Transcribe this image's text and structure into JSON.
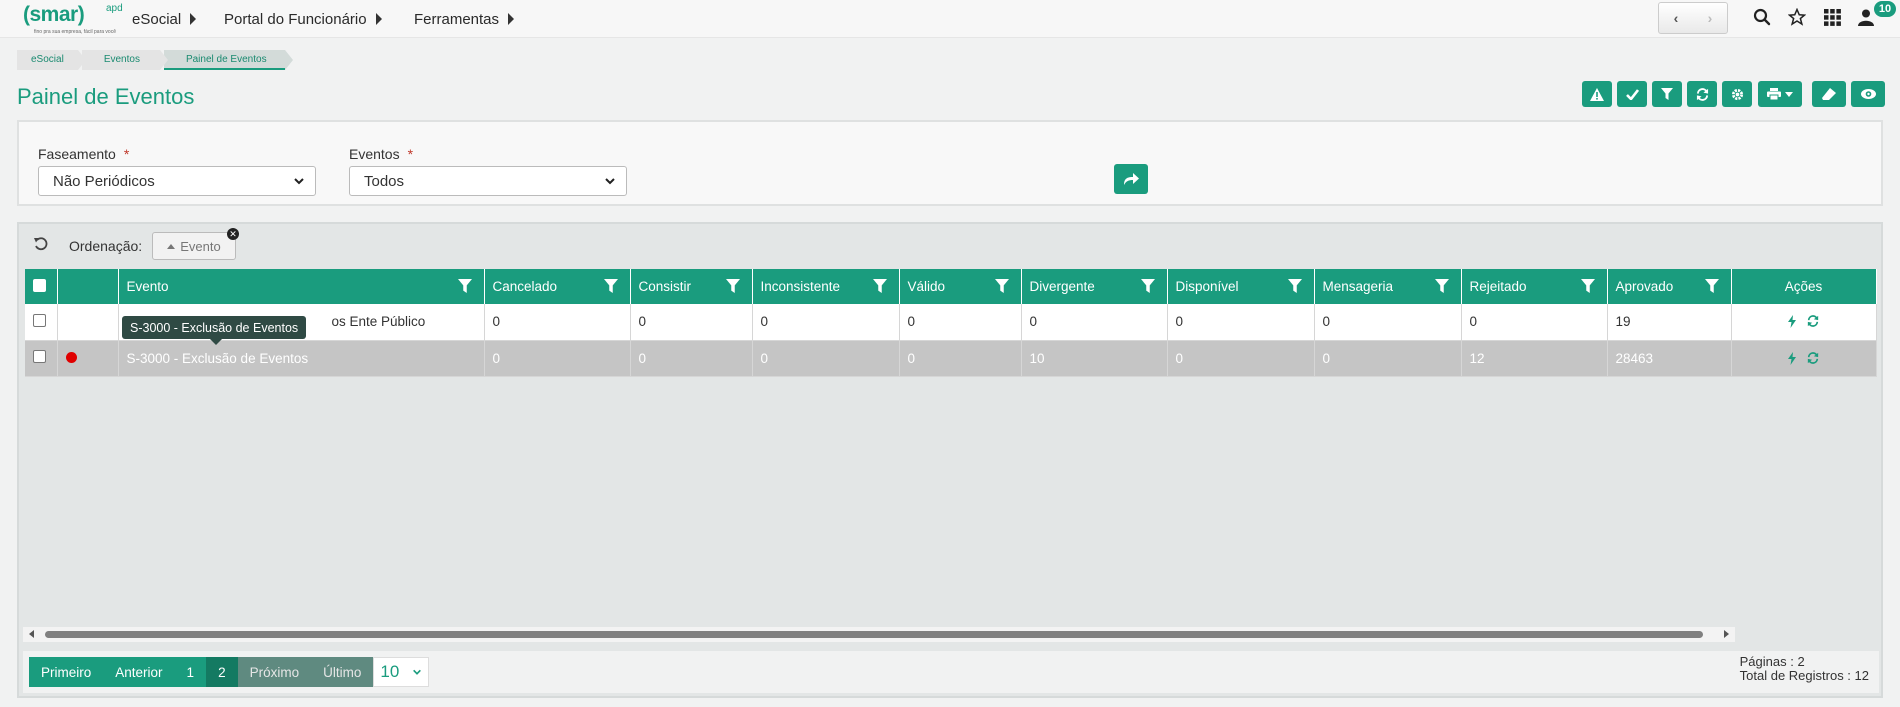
{
  "logo": {
    "text": "(smar)",
    "sup": "apd",
    "tagline": "fino pra sua empresa, fácil para você"
  },
  "nav": {
    "items": [
      {
        "label": "eSocial"
      },
      {
        "label": "Portal do Funcionário"
      },
      {
        "label": "Ferramentas"
      }
    ],
    "badge": "10",
    "icons": [
      "search-icon",
      "star-icon",
      "apps-grid-icon",
      "user-icon"
    ]
  },
  "breadcrumb": {
    "items": [
      "eSocial",
      "Eventos",
      "Painel de Eventos"
    ]
  },
  "page": {
    "title": "Painel de Eventos"
  },
  "toolbar": {
    "icons": [
      "warning-icon",
      "check-icon",
      "filter-icon",
      "refresh-icon",
      "settings-icon",
      "print-icon",
      "eraser-icon",
      "eye-icon"
    ]
  },
  "filters": {
    "faseamento": {
      "label": "Faseamento",
      "required": "*",
      "value": "Não Periódicos"
    },
    "eventos": {
      "label": "Eventos",
      "required": "*",
      "value": "Todos"
    }
  },
  "ordering": {
    "label": "Ordenação:",
    "chip": "Evento"
  },
  "grid": {
    "columns": [
      "Evento",
      "Cancelado",
      "Consistir",
      "Inconsistente",
      "Válido",
      "Divergente",
      "Disponível",
      "Mensageria",
      "Rejeitado",
      "Aprovado",
      "Ações"
    ],
    "rows": [
      {
        "evento": "S-1202 - Remuneração de Servidores Ente Público",
        "evento_visible": "os Ente Público",
        "cancelado": "0",
        "consistir": "0",
        "inconsistente": "0",
        "valido": "0",
        "divergente": "0",
        "disponivel": "0",
        "mensageria": "0",
        "rejeitado": "0",
        "aprovado": "19",
        "status": ""
      },
      {
        "evento": "S-3000 - Exclusão de Eventos",
        "cancelado": "0",
        "consistir": "0",
        "inconsistente": "0",
        "valido": "0",
        "divergente": "10",
        "disponivel": "0",
        "mensageria": "0",
        "rejeitado": "12",
        "aprovado": "28463",
        "status": "error"
      }
    ]
  },
  "tooltip": {
    "text": "S-3000 - Exclusão de Eventos"
  },
  "pager": {
    "first": "Primeiro",
    "prev": "Anterior",
    "pages": [
      "1",
      "2"
    ],
    "current": "2",
    "next": "Próximo",
    "last": "Último",
    "per_page": "10",
    "pages_info": "Páginas : 2",
    "total_info": "Total de Registros : 12"
  },
  "colors": {
    "primary": "#1a9c7e",
    "status_error": "#e00000",
    "selected_row": "#c5c5c5"
  }
}
